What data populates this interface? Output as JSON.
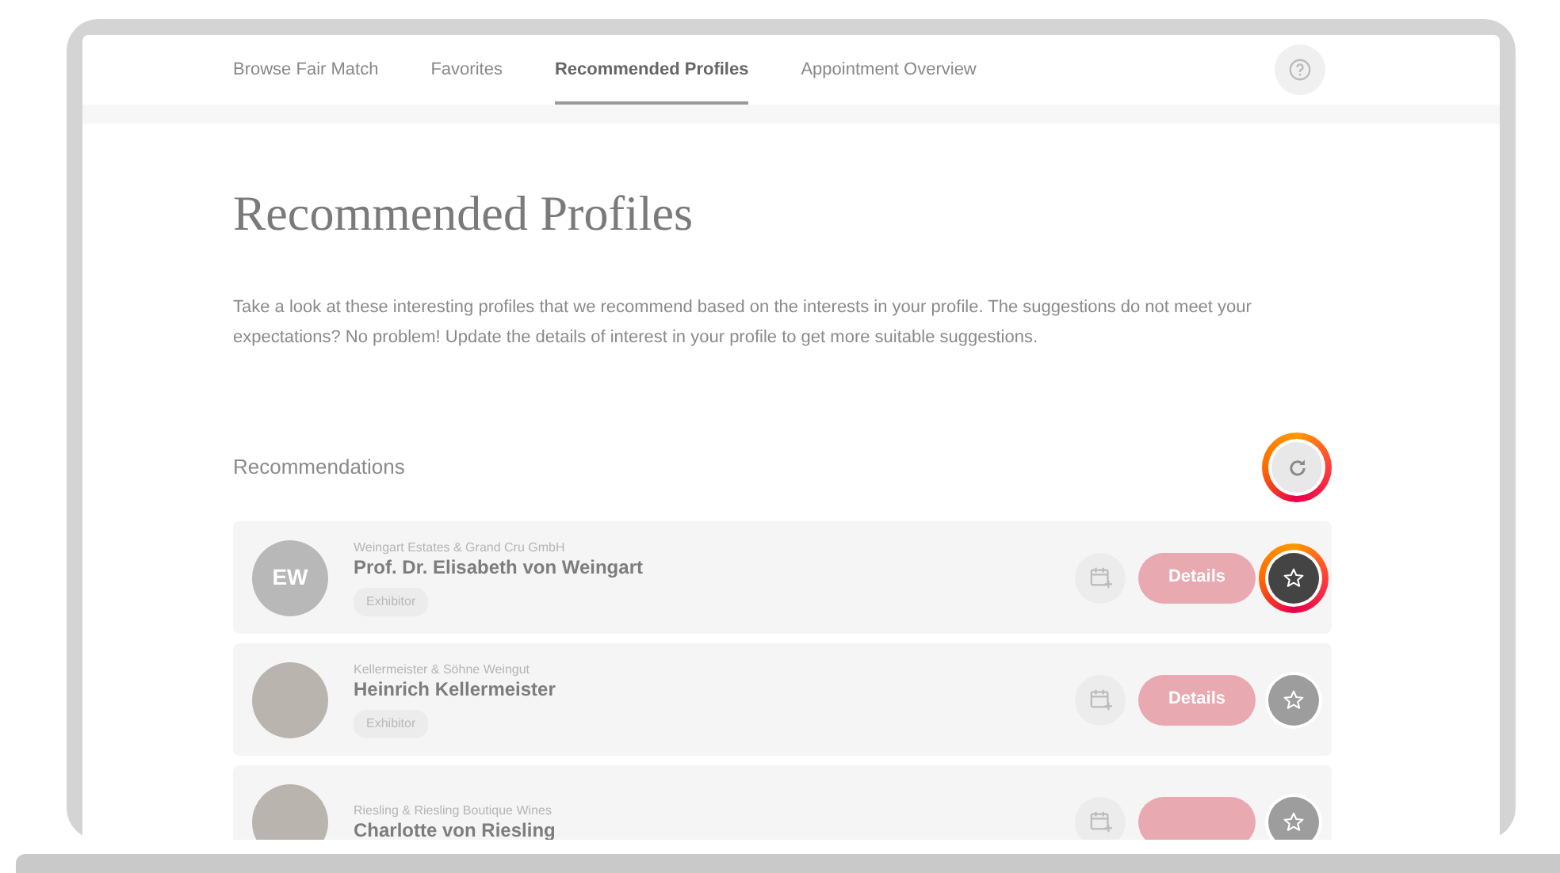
{
  "nav": {
    "tabs": [
      {
        "label": "Browse Fair Match",
        "selected": false
      },
      {
        "label": "Favorites",
        "selected": false
      },
      {
        "label": "Recommended Profiles",
        "selected": true
      },
      {
        "label": "Appointment Overview",
        "selected": false
      }
    ]
  },
  "title": "Recommended Profiles",
  "description": "Take a look at these interesting profiles that we recommend based on the interests in your profile. The suggestions do not meet your expectations? No problem! Update the details of interest in your profile to get more suitable suggestions.",
  "section": {
    "heading": "Recommendations",
    "refresh_highlighted": true
  },
  "profiles": [
    {
      "kind": "initials",
      "initials": "EW",
      "company": "Weingart Estates & Grand Cru GmbH",
      "name": "Prof. Dr. Elisabeth von Weingart",
      "role": "Exhibitor",
      "button": "Details",
      "star_highlighted": true
    },
    {
      "kind": "photo",
      "company": "Kellermeister & Söhne Weingut",
      "name": "Heinrich Kellermeister",
      "role": "Exhibitor",
      "button": "Details",
      "star_highlighted": false
    },
    {
      "kind": "photo",
      "company": "Riesling & Riesling Boutique Wines",
      "name": "Charlotte von Riesling",
      "star_highlighted": false
    }
  ]
}
